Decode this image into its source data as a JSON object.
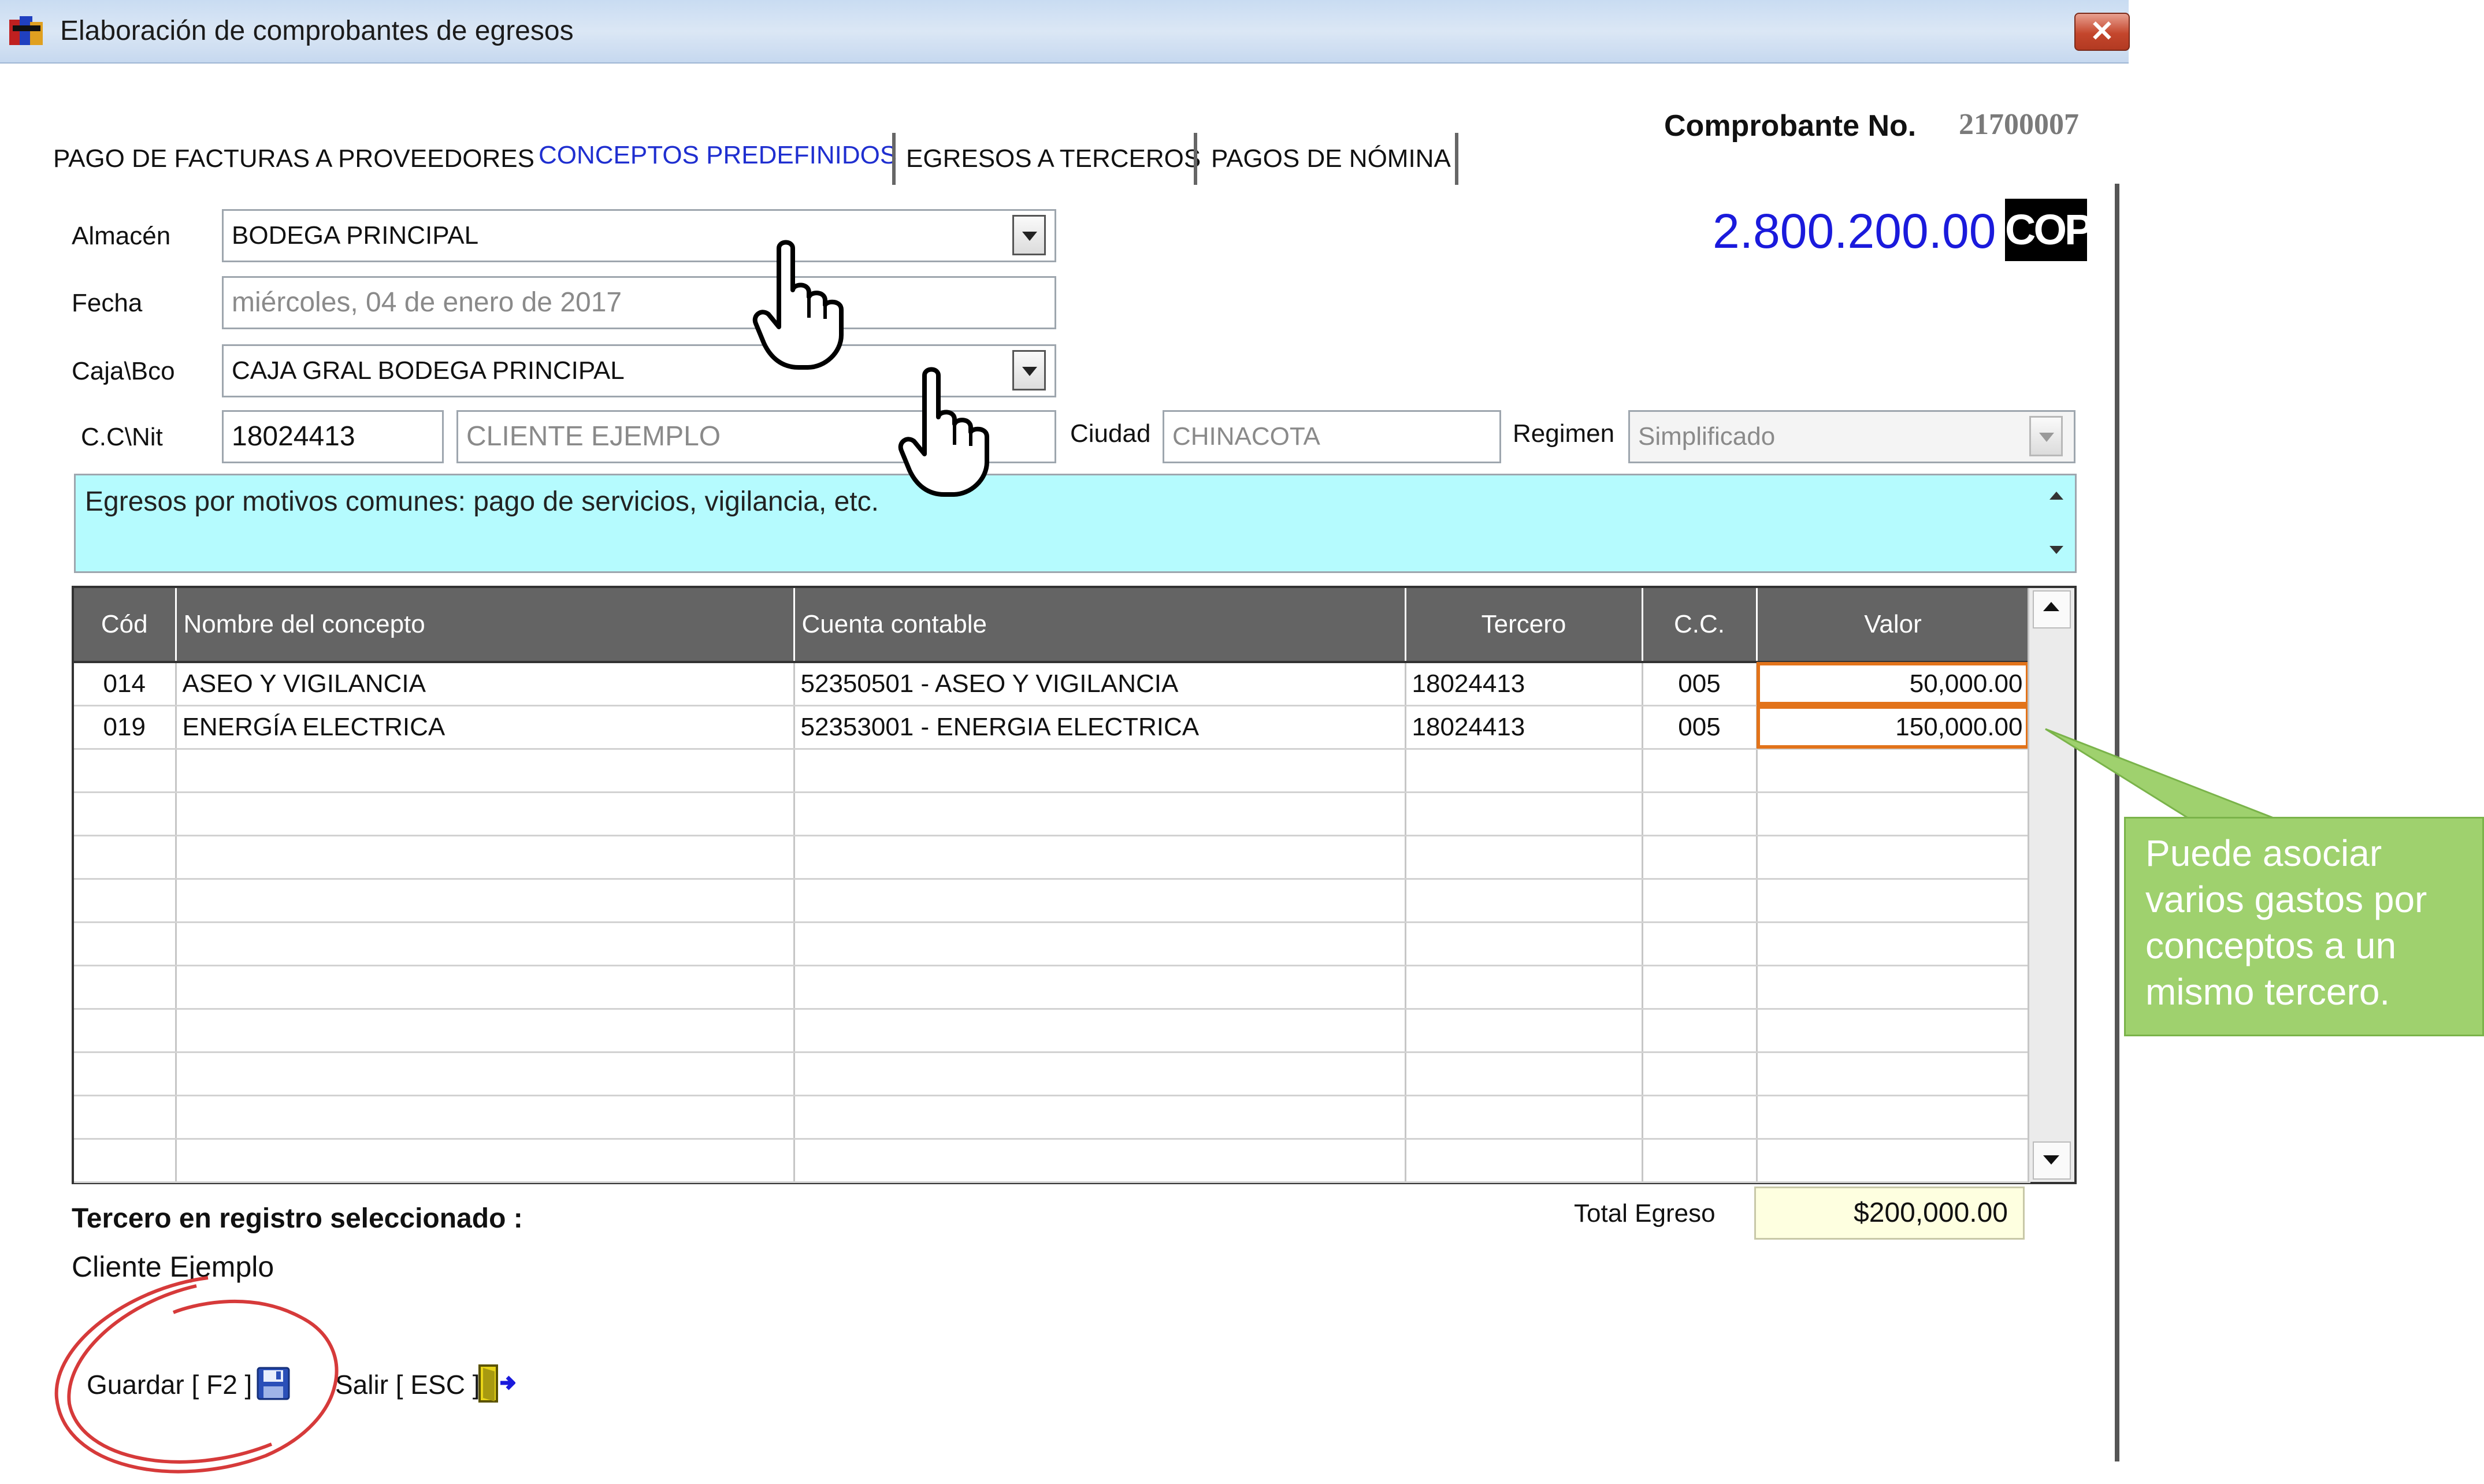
{
  "window": {
    "title": "Elaboración de comprobantes de egresos",
    "close_label": "✕"
  },
  "tabs": [
    {
      "label": "PAGO DE FACTURAS A PROVEEDORES"
    },
    {
      "label": "CONCEPTOS PREDEFINIDOS",
      "active": true
    },
    {
      "label": "EGRESOS A TERCEROS"
    },
    {
      "label": "PAGOS DE NÓMINA"
    }
  ],
  "header": {
    "comprobante_label": "Comprobante No.",
    "comprobante_num": "21700007",
    "amount": "2.800.200.00",
    "currency": "COP"
  },
  "form": {
    "almacen_label": "Almacén",
    "almacen_value": "BODEGA PRINCIPAL",
    "fecha_label": "Fecha",
    "fecha_value": "miércoles, 04 de enero de 2017",
    "caja_label": "Caja\\Bco",
    "caja_value": "CAJA GRAL BODEGA PRINCIPAL",
    "ccnit_label": "C.C\\Nit",
    "ccnit_value": "18024413",
    "cliente_value": "CLIENTE EJEMPLO",
    "ciudad_label": "Ciudad",
    "ciudad_value": "CHINACOTA",
    "regimen_label": "Regimen",
    "regimen_value": "Simplificado",
    "memo": "Egresos por motivos comunes: pago de servicios, vigilancia, etc."
  },
  "grid": {
    "columns": [
      "Cód",
      "Nombre del concepto",
      "Cuenta contable",
      "Tercero",
      "C.C.",
      "Valor"
    ],
    "rows": [
      [
        "014",
        "ASEO Y VIGILANCIA",
        "52350501 - ASEO Y VIGILANCIA",
        "18024413",
        "005",
        "50,000.00"
      ],
      [
        "019",
        "ENERGÍA ELECTRICA",
        "52353001 - ENERGIA ELECTRICA",
        "18024413",
        "005",
        "150,000.00"
      ]
    ],
    "empty_rows": 10
  },
  "footer": {
    "tercero_label": "Tercero en registro seleccionado :",
    "tercero_value": "Cliente Ejemplo",
    "total_label": "Total Egreso",
    "total_value": "$200,000.00",
    "guardar_label": "Guardar [ F2 ]",
    "salir_label": "Salir [ ESC ]"
  },
  "callout": {
    "text": "Puede asociar varios gastos por conceptos a un mismo tercero."
  },
  "colors": {
    "accent_tab": "#1f2fd0",
    "amount": "#1a1adc",
    "memo_bg": "#b5fbfe",
    "highlight": "#e2731a",
    "callout_bg": "#9fd16e",
    "annotation_red": "#d63a3a"
  },
  "icons": [
    "app-icon",
    "close-icon",
    "dropdown-arrow-icon",
    "hand-pointer-icon",
    "save-disk-icon",
    "exit-door-icon"
  ]
}
